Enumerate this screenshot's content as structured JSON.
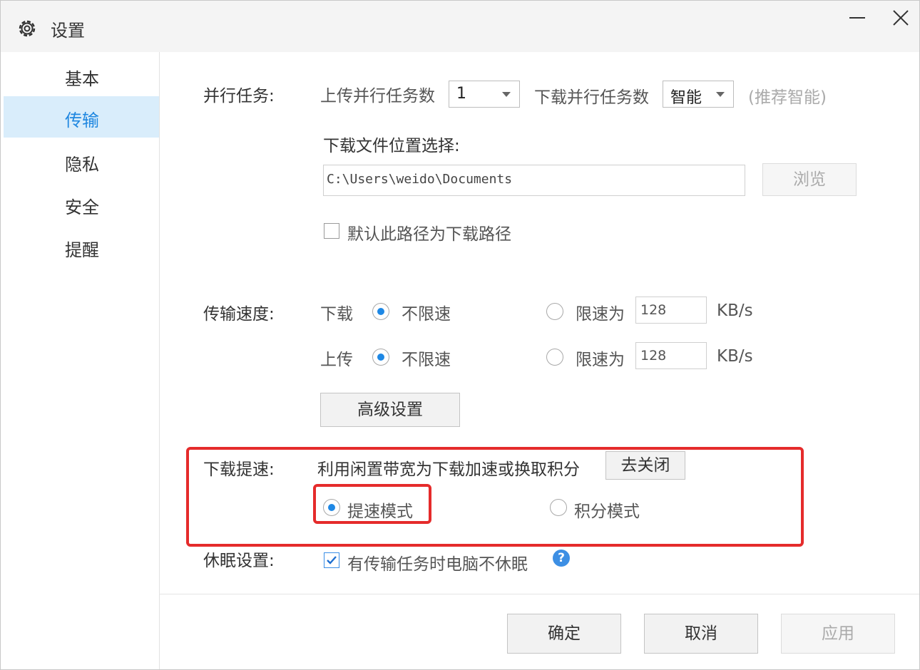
{
  "window": {
    "title": "设置"
  },
  "sidebar": {
    "items": [
      {
        "label": "基本",
        "active": false
      },
      {
        "label": "传输",
        "active": true
      },
      {
        "label": "隐私",
        "active": false
      },
      {
        "label": "安全",
        "active": false
      },
      {
        "label": "提醒",
        "active": false
      }
    ]
  },
  "parallel": {
    "label": "并行任务:",
    "upload_label": "上传并行任务数",
    "upload_value": "1",
    "download_label": "下载并行任务数",
    "download_value": "智能",
    "recommend": "(推荐智能)"
  },
  "location": {
    "label": "下载文件位置选择:",
    "path": "C:\\Users\\weido\\Documents",
    "browse": "浏览",
    "default_checkbox": "默认此路径为下载路径",
    "default_checked": false
  },
  "speed": {
    "label": "传输速度:",
    "download_label": "下载",
    "upload_label": "上传",
    "unlimited": "不限速",
    "limit_to": "限速为",
    "download_limit": "128",
    "upload_limit": "128",
    "unit": "KB/s",
    "download_mode": "unlimited",
    "upload_mode": "unlimited",
    "advanced": "高级设置"
  },
  "accel": {
    "label": "下载提速:",
    "desc": "利用闲置带宽为下载加速或换取积分",
    "close_button": "去关闭",
    "mode_speed": "提速模式",
    "mode_points": "积分模式",
    "selected": "speed"
  },
  "sleep": {
    "label": "休眠设置:",
    "checkbox": "有传输任务时电脑不休眠",
    "checked": true
  },
  "footer": {
    "ok": "确定",
    "cancel": "取消",
    "apply": "应用"
  },
  "colors": {
    "accent": "#1e88e5",
    "highlight_box": "#e52b2b",
    "active_bg": "#d9edfb"
  }
}
